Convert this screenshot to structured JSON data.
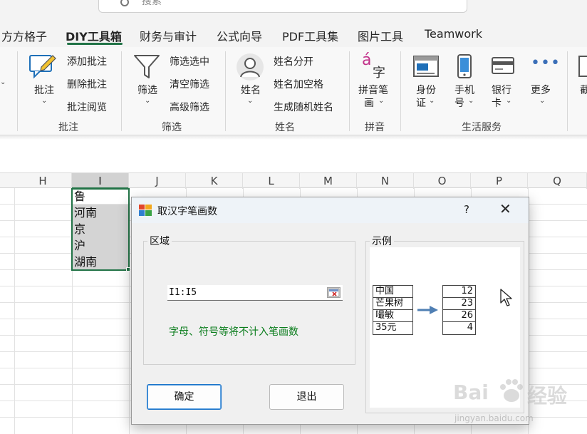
{
  "search": {
    "placeholder": "搜索"
  },
  "tabs": [
    {
      "label": "方方格子"
    },
    {
      "label": "DIY工具箱"
    },
    {
      "label": "财务与审计"
    },
    {
      "label": "公式向导"
    },
    {
      "label": "PDF工具集"
    },
    {
      "label": "图片工具"
    },
    {
      "label": "Teamwork"
    }
  ],
  "ribbon": {
    "annotation": {
      "big": "批注",
      "items": [
        "添加批注",
        "删除批注",
        "批注阅览"
      ],
      "group": "批注"
    },
    "filter": {
      "big": "筛选",
      "items": [
        "筛选选中",
        "清空筛选",
        "高级筛选"
      ],
      "group": "筛选"
    },
    "name": {
      "big": "姓名",
      "items": [
        "姓名分开",
        "姓名加空格",
        "生成随机姓名"
      ],
      "group": "姓名"
    },
    "pinyin": {
      "big_line1": "拼音笔",
      "big_line2": "画",
      "icon_glyph": "á",
      "icon_glyph2": "字",
      "group": "拼音"
    },
    "life": {
      "id_line1": "身份",
      "id_line2": "证",
      "phone_line1": "手机",
      "phone_line2": "号",
      "bank_line1": "银行",
      "bank_line2": "卡",
      "more": "更多",
      "group": "生活服务",
      "partial_next": "截"
    }
  },
  "grid": {
    "columns": [
      "H",
      "I",
      "J",
      "K",
      "L",
      "M",
      "N",
      "O",
      "P",
      "Q"
    ],
    "selected_column": "I",
    "cells": [
      "鲁",
      "河南",
      "京",
      "沪",
      "湖南"
    ]
  },
  "dialog": {
    "title": "取汉字笔画数",
    "help": "?",
    "close": "✕",
    "region_label": "区域",
    "range_value": "I1:I5",
    "note": "字母、符号等将不计入笔画数",
    "example_label": "示例",
    "ok_label": "确定",
    "exit_label": "退出",
    "example_words": [
      "中国",
      "芒果树",
      "嘬敏",
      "35元"
    ],
    "example_counts": [
      "12",
      "23",
      "26",
      "4"
    ]
  },
  "watermark": {
    "brand": "Bai",
    "brand2": "经验",
    "url": "jingyan.baidu.com"
  },
  "colors": {
    "accent_green": "#217346",
    "note_green": "#0a7d1c",
    "primary_border": "#1a73c9"
  }
}
